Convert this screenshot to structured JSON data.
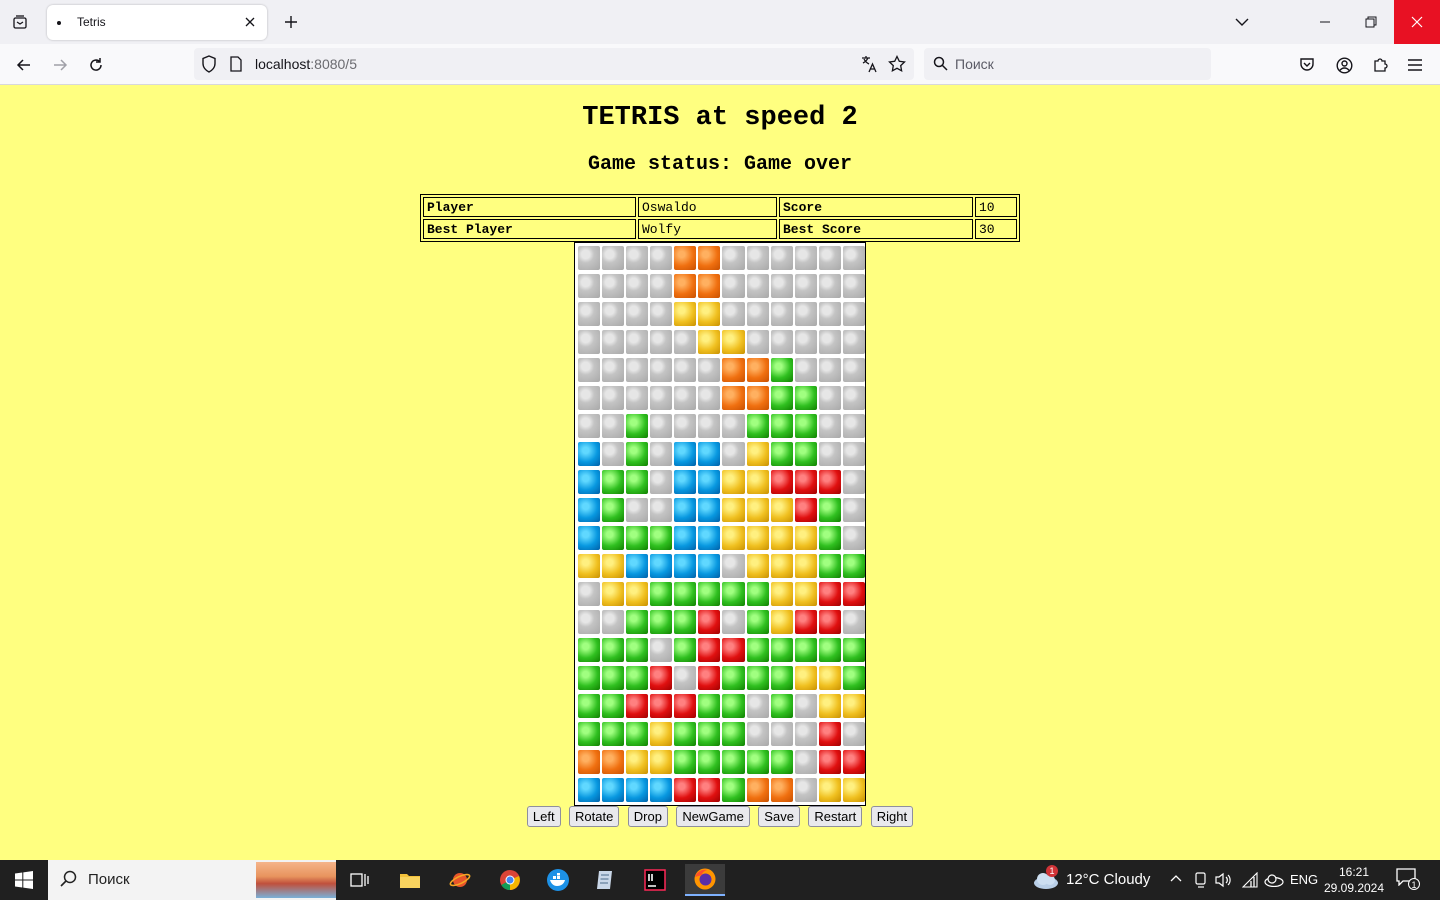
{
  "browser": {
    "tab_title": "Tetris",
    "url_host": "localhost",
    "url_rest": ":8080/5",
    "search_placeholder": "Поиск"
  },
  "page": {
    "title": "TETRIS at speed 2",
    "status": "Game status: Game over",
    "info": {
      "player_label": "Player",
      "player_value": "Oswaldo",
      "score_label": "Score",
      "score_value": "10",
      "best_player_label": "Best Player",
      "best_player_value": "Wolfy",
      "best_score_label": "Best Score",
      "best_score_value": "30"
    },
    "board": {
      "colors": {
        "G": "gray",
        "O": "orange",
        "Y": "yellow",
        "E": "green",
        "B": "blue",
        "R": "red"
      },
      "rows": [
        "GGGGOOGGGGGG",
        "GGGGOOGGGGGG",
        "GGGGYYGGGGGG",
        "GGGGGYYGGGGG",
        "GGGGGGOOEGGG",
        "GGGGGGOOEEGG",
        "GGEGGGGEEEGG",
        "BGEGBBGYEEGG",
        "BEEGBBYYRRRG",
        "BEGGBBYYYREG",
        "BEEEBBYYYYEG",
        "YYBBBBGYYYEE",
        "GYYEEEEEYYRR",
        "GGEEERGEYRRG",
        "EEEGERREEEEE",
        "EEERGREEEYYE",
        "EERRREEGEGYY",
        "EEEYEEEGGGRG",
        "OOYYEEEEEGRR",
        "BBBBRREOOGYY"
      ]
    },
    "controls": {
      "left": "Left",
      "rotate": "Rotate",
      "drop": "Drop",
      "newgame": "NewGame",
      "save": "Save",
      "restart": "Restart",
      "right": "Right"
    }
  },
  "taskbar": {
    "search_placeholder": "Поиск",
    "weather": "12°C  Cloudy",
    "lang": "ENG",
    "time": "16:21",
    "date": "29.09.2024",
    "notification_count": "1",
    "weather_badge": "1"
  }
}
